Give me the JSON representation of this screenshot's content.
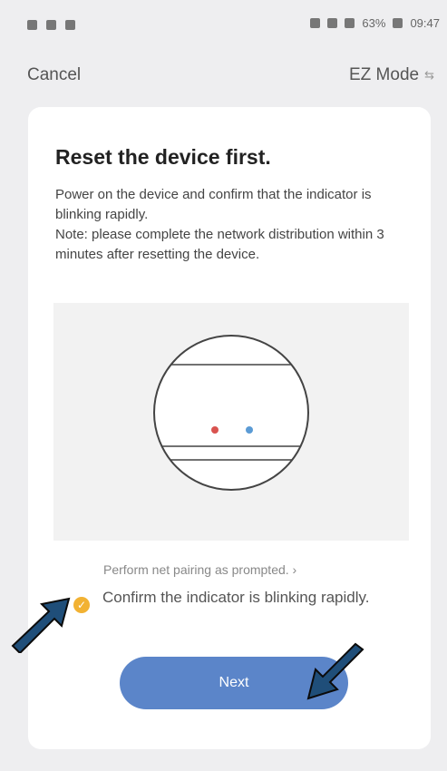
{
  "status_bar": {
    "battery": "63%",
    "time": "09:47"
  },
  "header": {
    "cancel_label": "Cancel",
    "mode_label": "EZ Mode",
    "mode_icon": "swap-arrows-icon"
  },
  "card": {
    "title": "Reset the device first.",
    "description": "Power on the device and confirm that the indicator is blinking rapidly.\nNote: please complete the network distribution within 3 minutes after resetting the device.",
    "prompt_link": "Perform net pairing as prompted. ›",
    "confirm_text": "Confirm the indicator is blinking rapidly.",
    "confirm_checked": true,
    "next_label": "Next"
  },
  "colors": {
    "accent": "#5b85c9",
    "check": "#f2b233",
    "led_red": "#d9534f",
    "led_blue": "#5b9bd5",
    "annotation_arrow": "#1f4e79"
  }
}
